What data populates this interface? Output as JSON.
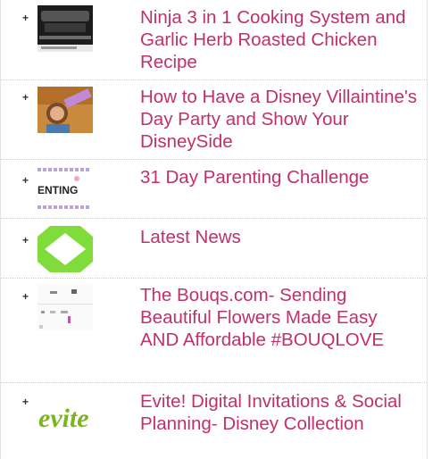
{
  "widget": {
    "bullet_glyph": "+",
    "link_color": "#c0306a",
    "posts": [
      {
        "title": "Ninja 3 in 1 Cooking System and Garlic Herb Roasted Chicken Recipe",
        "thumbnail": "ninja-cooking-thumbnail"
      },
      {
        "title": "How to Have a Disney Villaintine's Day Party and Show Your DisneySide",
        "thumbnail": "villaintine-party-thumbnail"
      },
      {
        "title": "31 Day Parenting Challenge",
        "thumbnail": "parenting-challenge-thumbnail",
        "thumb_text": "ENTING"
      },
      {
        "title": "Latest News",
        "thumbnail": "latest-news-thumbnail"
      },
      {
        "title": "The Bouqs.com- Sending Beautiful Flowers Made Easy AND Affordable #BOUQLOVE",
        "thumbnail": "bouqs-thumbnail"
      },
      {
        "title": "Evite! Digital Invitations & Social Planning- Disney Collection",
        "thumbnail": "evite-logo-thumbnail",
        "thumb_text": "evite"
      }
    ]
  }
}
